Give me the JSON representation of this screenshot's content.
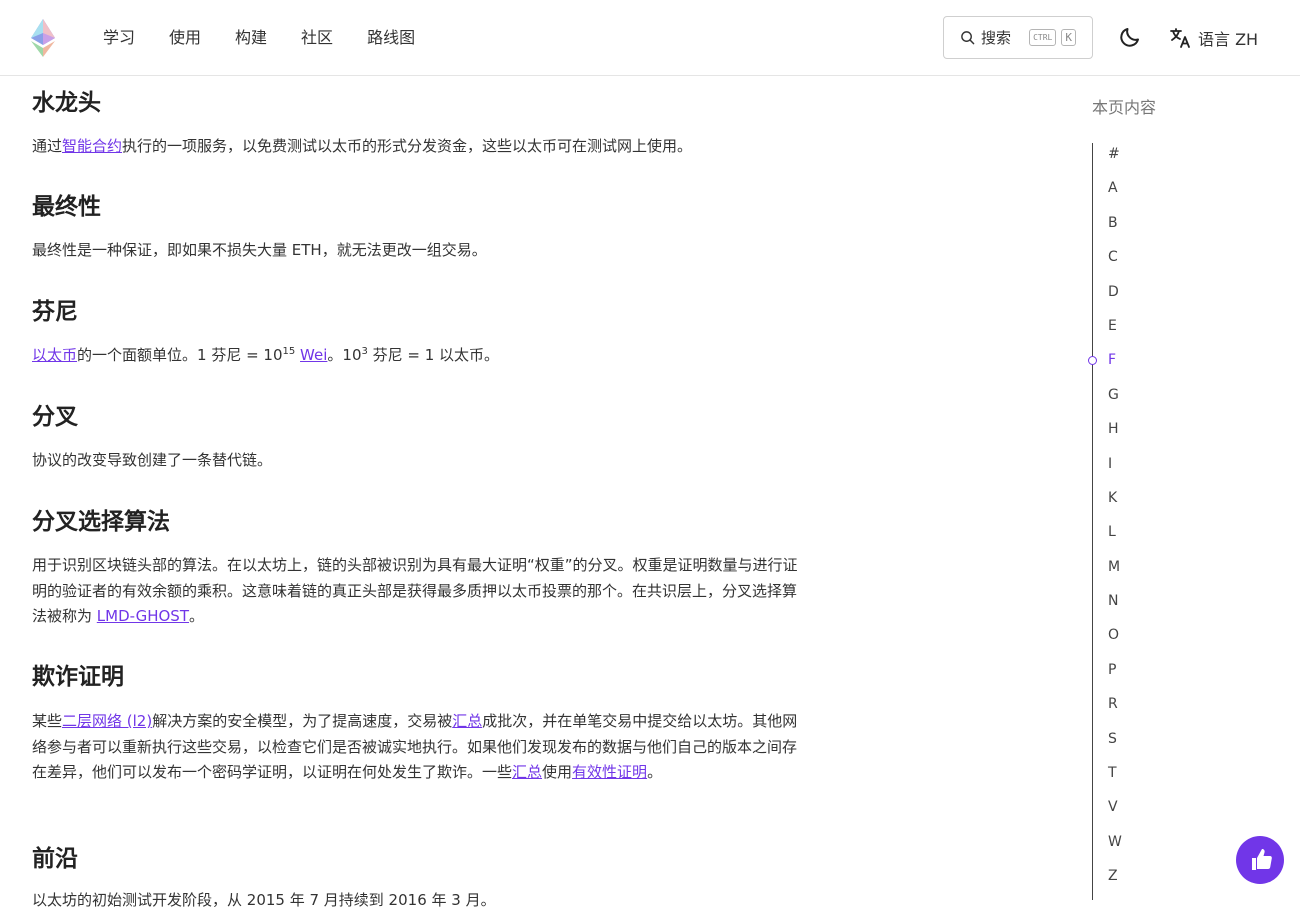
{
  "header": {
    "nav": [
      "学习",
      "使用",
      "构建",
      "社区",
      "路线图"
    ],
    "search_label": "搜索",
    "kbd_ctrl": "CTRL",
    "kbd_k": "K",
    "language_label": "语言 ZH"
  },
  "terms": [
    {
      "title": "水龙头",
      "body": [
        {
          "t": "通过"
        },
        {
          "t": "智能合约",
          "link": true
        },
        {
          "t": "执行的一项服务，以免费测试以太币的形式分发资金，这些以太币可在测试网上使用。"
        }
      ]
    },
    {
      "title": "最终性",
      "body": [
        {
          "t": "最终性是一种保证，即如果不损失大量 ETH，就无法更改一组交易。"
        }
      ]
    },
    {
      "title": "芬尼",
      "body": [
        {
          "t": "以太币",
          "link": true
        },
        {
          "t": "的一个面额单位。1 芬尼 = 10"
        },
        {
          "t": "15",
          "sup": true
        },
        {
          "t": " "
        },
        {
          "t": "Wei",
          "link": true
        },
        {
          "t": "。10"
        },
        {
          "t": "3",
          "sup": true
        },
        {
          "t": " 芬尼 = 1 以太币。"
        }
      ]
    },
    {
      "title": "分叉",
      "body": [
        {
          "t": "协议的改变导致创建了一条替代链。"
        }
      ]
    },
    {
      "title": "分叉选择算法",
      "body": [
        {
          "t": "用于识别区块链头部的算法。在以太坊上，链的头部被识别为具有最大证明“权重”的分叉。权重是证明数量与进行证明的验证者的有效余额的乘积。这意味着链的真正头部是获得最多质押以太币投票的那个。在共识层上，分叉选择算法被称为 "
        },
        {
          "t": "LMD-GHOST",
          "link": true
        },
        {
          "t": "。"
        }
      ]
    },
    {
      "title": "欺诈证明",
      "body": [
        {
          "t": "某些"
        },
        {
          "t": "二层网络 (l2)",
          "link": true
        },
        {
          "t": "解决方案的安全模型，为了提高速度，交易被"
        },
        {
          "t": "汇总",
          "link": true
        },
        {
          "t": "成批次，并在单笔交易中提交给以太坊。其他网络参与者可以重新执行这些交易，以检查它们是否被诚实地执行。如果他们发现发布的数据与他们自己的版本之间存在差异，他们可以发布一个密码学证明，以证明在何处发生了欺诈。一些"
        },
        {
          "t": "汇总",
          "link": true
        },
        {
          "t": "使用"
        },
        {
          "t": "有效性证明",
          "link": true
        },
        {
          "t": "。"
        }
      ]
    },
    {
      "title": "前沿",
      "body": [
        {
          "t": "以太坊的初始测试开发阶段，从 2015 年 7 月持续到 2016 年 3 月。"
        }
      ]
    }
  ],
  "toc": {
    "title": "本页内容",
    "items": [
      "#",
      "A",
      "B",
      "C",
      "D",
      "E",
      "F",
      "G",
      "H",
      "I",
      "K",
      "L",
      "M",
      "N",
      "O",
      "P",
      "R",
      "S",
      "T",
      "V",
      "W",
      "Z"
    ],
    "active": "F"
  },
  "colors": {
    "accent": "#7136e8",
    "text": "#333333"
  }
}
